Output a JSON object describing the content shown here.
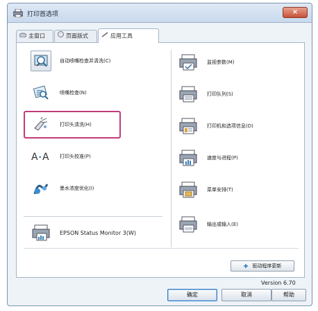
{
  "window": {
    "title": "打印首选项",
    "close_label": "×"
  },
  "tabs": [
    {
      "label": "主窗口",
      "icon": "main-window-icon"
    },
    {
      "label": "页面版式",
      "icon": "page-layout-icon"
    },
    {
      "label": "应用工具",
      "icon": "utility-tools-icon",
      "active": true
    }
  ],
  "left_items": [
    {
      "label": "自动喷嘴检查并清洗(C)",
      "icon": "auto-nozzle-check-icon"
    },
    {
      "label": "喷嘴检查(N)",
      "icon": "nozzle-check-icon"
    },
    {
      "label": "打印头清洗(H)",
      "icon": "head-cleaning-icon"
    },
    {
      "label": "打印头校准(P)",
      "icon": "head-alignment-icon"
    },
    {
      "label": "墨水浓度优化(I)",
      "icon": "ink-density-icon"
    }
  ],
  "status_monitor": {
    "label": "EPSON Status Monitor 3(W)",
    "icon": "status-monitor-icon"
  },
  "right_items": [
    {
      "label": "监视参数(M)",
      "icon": "monitoring-preferences-icon"
    },
    {
      "label": "打印队列(S)",
      "icon": "print-queue-icon"
    },
    {
      "label": "打印机和选项信息(D)",
      "icon": "printer-info-icon"
    },
    {
      "label": "速度与进程(P)",
      "icon": "speed-progress-icon"
    },
    {
      "label": "菜单安排(T)",
      "icon": "menu-arrangement-icon"
    },
    {
      "label": "输出或输入(E)",
      "icon": "export-import-icon"
    }
  ],
  "update_button": {
    "label": "驱动程序更新",
    "icon": "update-icon"
  },
  "version": "Version 6.70",
  "footer": {
    "ok": "确定",
    "cancel": "取消",
    "help": "帮助"
  },
  "colors": {
    "highlight": "#c23b7a",
    "titlebar": "#c9d9ec",
    "close": "#c8523a"
  }
}
